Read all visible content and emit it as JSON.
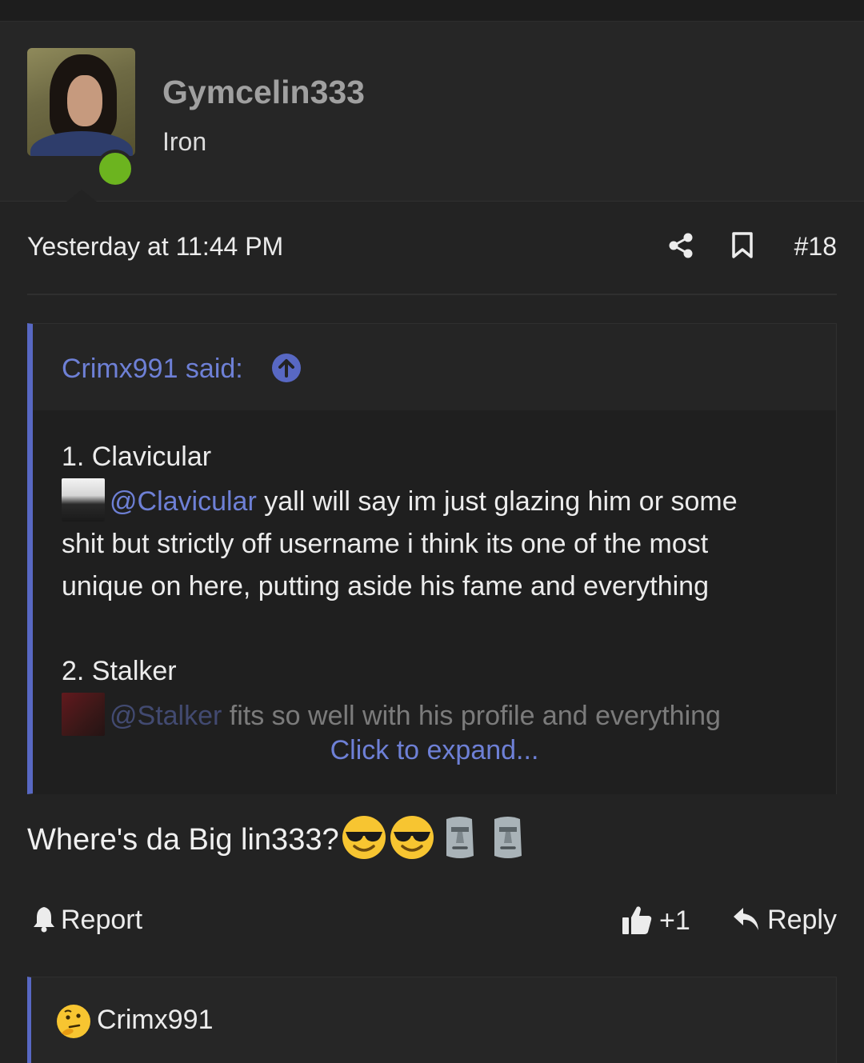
{
  "user": {
    "name": "Gymcelin333",
    "rank": "Iron"
  },
  "post": {
    "timestamp": "Yesterday at 11:44 PM",
    "number": "#18",
    "message": "Where's da Big lin333?",
    "emojis": [
      "smiling-face-with-sunglasses",
      "smiling-face-with-sunglasses",
      "moai",
      "moai"
    ]
  },
  "quote": {
    "author_label": "Crimx991 said:",
    "item1_title": "1. Clavicular",
    "item1_mention": "@Clavicular",
    "item1_text_a": " yall will say im just glazing him or some",
    "item1_text_b": "shit but strictly off username i think its one of the most",
    "item1_text_c": "unique on here, putting aside his fame and everything",
    "item2_title": "2. Stalker",
    "item2_mention": "@Stalker",
    "item2_text": " fits so well with his profile and everything",
    "expand_label": "Click to expand..."
  },
  "actions": {
    "report_label": "Report",
    "like_count": "+1",
    "reply_label": "Reply"
  },
  "reactions": {
    "user": "Crimx991",
    "emoji": "thinking-face"
  },
  "colors": {
    "accent": "#5868c3",
    "link": "#6e80d6",
    "online": "#6cb41f",
    "background": "#232323"
  }
}
